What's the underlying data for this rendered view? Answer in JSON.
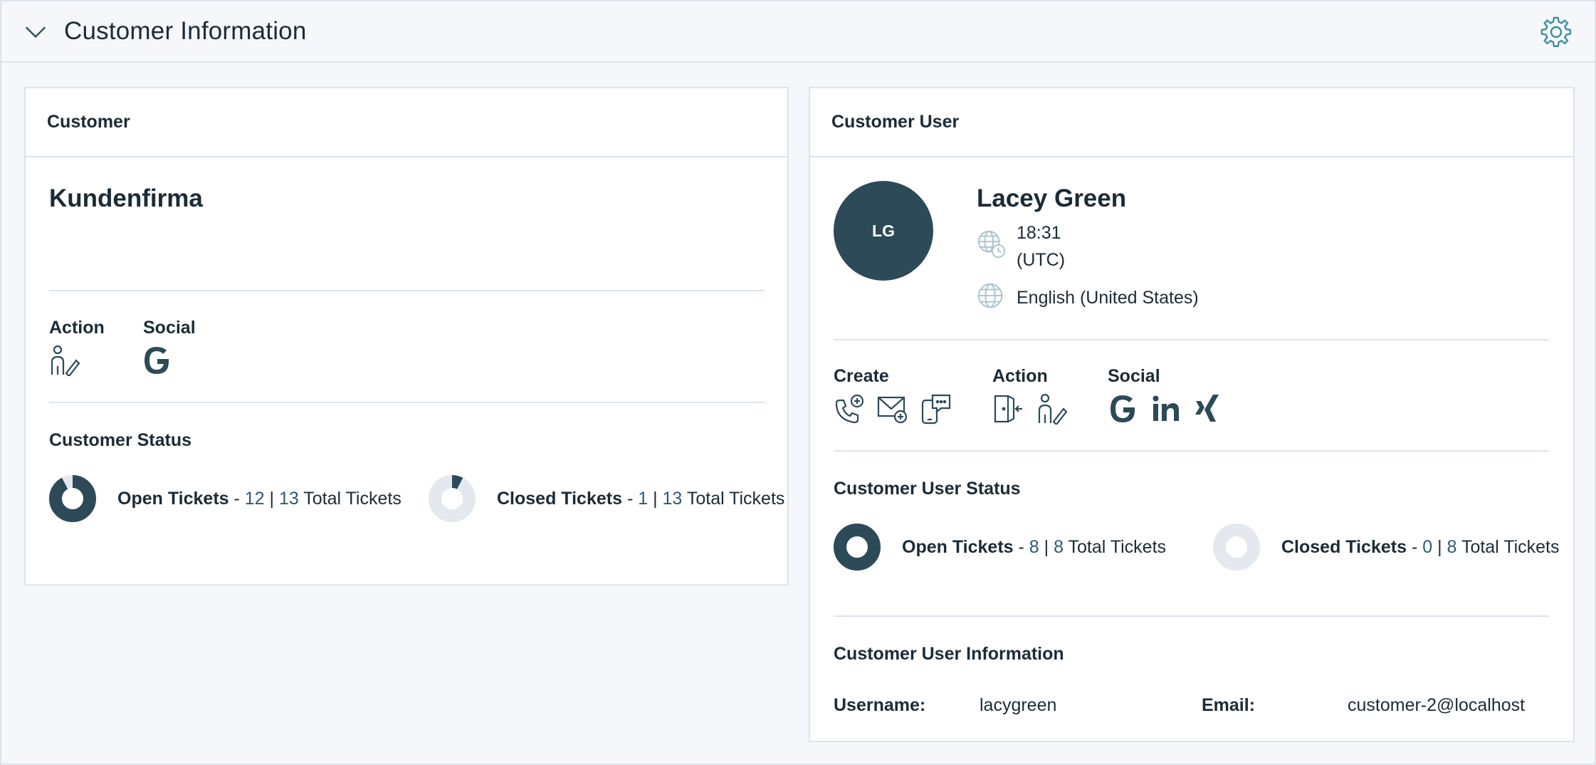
{
  "widget": {
    "title": "Customer Information"
  },
  "customer": {
    "header": "Customer",
    "name": "Kundenfirma",
    "action_label": "Action",
    "social_label": "Social",
    "status_title": "Customer Status",
    "open": {
      "label": "Open Tickets",
      "count": "12",
      "total": "13",
      "total_label": "Total Tickets",
      "fraction": 0.923
    },
    "closed": {
      "label": "Closed Tickets",
      "count": "1",
      "total": "13",
      "total_label": "Total Tickets",
      "fraction": 0.077
    }
  },
  "customer_user": {
    "header": "Customer User",
    "initials": "LG",
    "name": "Lacey Green",
    "time": "18:31",
    "timezone": "(UTC)",
    "language": "English (United States)",
    "create_label": "Create",
    "action_label": "Action",
    "social_label": "Social",
    "status_title": "Customer User Status",
    "open": {
      "label": "Open Tickets",
      "count": "8",
      "total": "8",
      "total_label": "Total Tickets",
      "fraction": 1.0
    },
    "closed": {
      "label": "Closed Tickets",
      "count": "0",
      "total": "8",
      "total_label": "Total Tickets",
      "fraction": 0.0
    },
    "info_title": "Customer User Information",
    "username_label": "Username:",
    "username": "lacygreen",
    "email_label": "Email:",
    "email": "customer-2@localhost"
  },
  "colors": {
    "dark": "#2c4a57",
    "ring_bg": "#e3e9ef",
    "accent": "#3a8ca0",
    "link": "#2e5a6e"
  },
  "icons": [
    "chevron-down-icon",
    "gear-icon",
    "person-edit-icon",
    "google-icon",
    "linkedin-icon",
    "xing-icon",
    "phone-add-icon",
    "email-add-icon",
    "chat-add-icon",
    "login-icon",
    "globe-clock-icon",
    "globe-icon"
  ]
}
